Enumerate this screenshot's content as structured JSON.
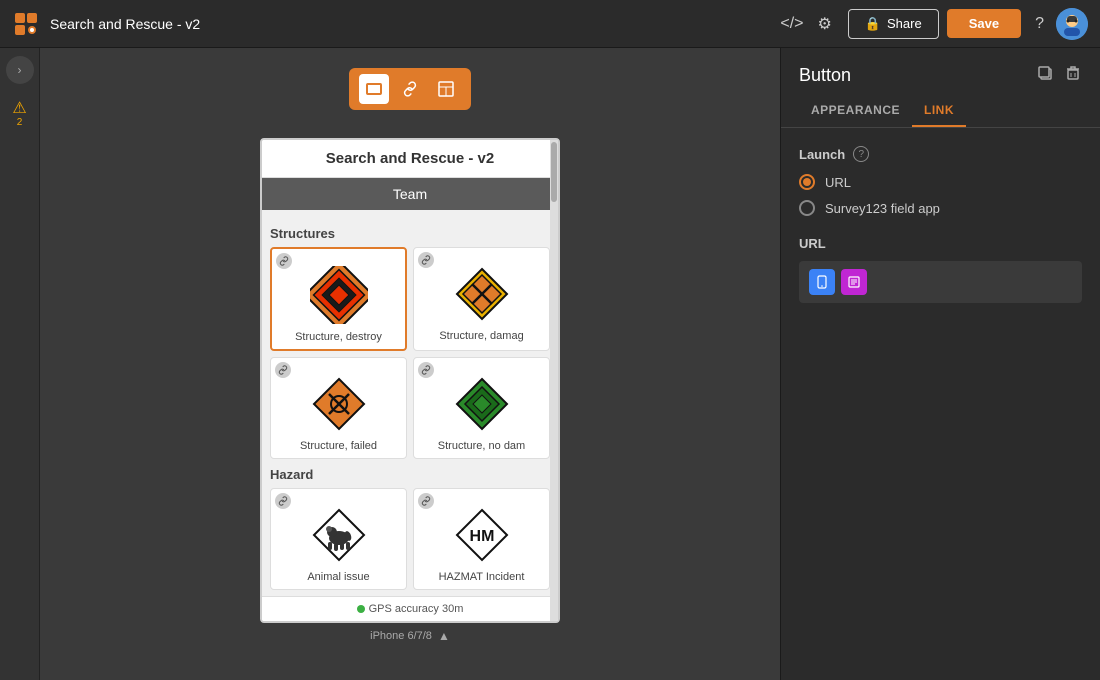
{
  "topbar": {
    "title": "Search and Rescue - v2",
    "share_label": "Share",
    "save_label": "Save",
    "lock_icon": "🔒",
    "code_icon": "</>",
    "settings_icon": "⚙"
  },
  "device_toolbar": {
    "buttons": [
      {
        "id": "rect",
        "icon": "▭",
        "active": true
      },
      {
        "id": "link",
        "icon": "🔗",
        "active": false
      },
      {
        "id": "layout",
        "icon": "▢",
        "active": false
      }
    ]
  },
  "phone": {
    "title": "Search and Rescue - v2",
    "team_header": "Team",
    "structures_label": "Structures",
    "hazard_label": "Hazard",
    "gps_text": "GPS accuracy 30m",
    "footer_label": "iPhone 6/7/8",
    "cards": [
      {
        "id": "destroy",
        "label": "Structure, destroy",
        "selected": true
      },
      {
        "id": "damaged",
        "label": "Structure, damag"
      },
      {
        "id": "failed",
        "label": "Structure, failed"
      },
      {
        "id": "nodam",
        "label": "Structure, no dam"
      },
      {
        "id": "animal",
        "label": "Animal issue"
      },
      {
        "id": "hazmat",
        "label": "HAZMAT Incident"
      }
    ]
  },
  "right_panel": {
    "title": "Button",
    "tab_appearance": "APPEARANCE",
    "tab_link": "LINK",
    "launch_label": "Launch",
    "launch_options": [
      {
        "id": "url",
        "label": "URL",
        "checked": true
      },
      {
        "id": "survey123",
        "label": "Survey123 field app",
        "checked": false
      }
    ],
    "url_label": "URL",
    "duplicate_icon": "⧉",
    "delete_icon": "🗑"
  },
  "warnings": {
    "count": "2",
    "icon": "⚠"
  }
}
